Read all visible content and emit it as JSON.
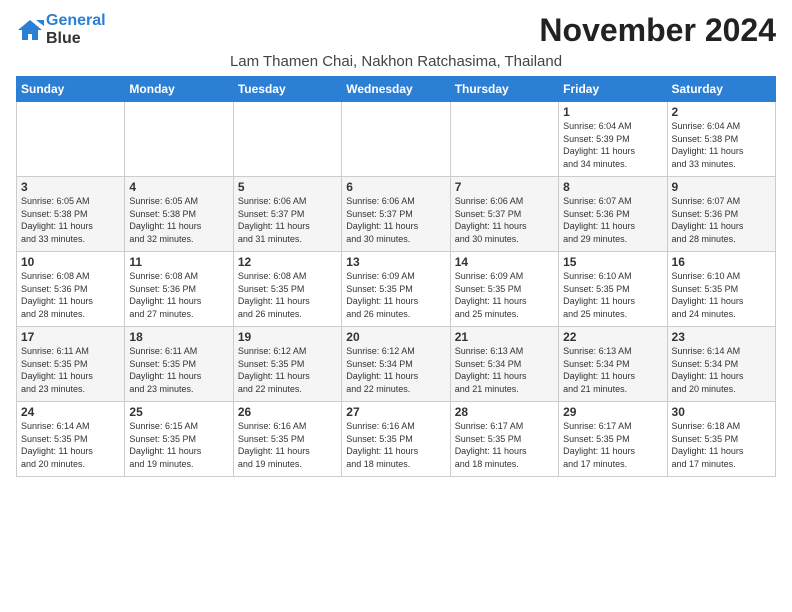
{
  "header": {
    "logo_line1": "General",
    "logo_line2": "Blue",
    "month_title": "November 2024",
    "location": "Lam Thamen Chai, Nakhon Ratchasima, Thailand"
  },
  "weekdays": [
    "Sunday",
    "Monday",
    "Tuesday",
    "Wednesday",
    "Thursday",
    "Friday",
    "Saturday"
  ],
  "weeks": [
    [
      {
        "day": "",
        "info": ""
      },
      {
        "day": "",
        "info": ""
      },
      {
        "day": "",
        "info": ""
      },
      {
        "day": "",
        "info": ""
      },
      {
        "day": "",
        "info": ""
      },
      {
        "day": "1",
        "info": "Sunrise: 6:04 AM\nSunset: 5:39 PM\nDaylight: 11 hours\nand 34 minutes."
      },
      {
        "day": "2",
        "info": "Sunrise: 6:04 AM\nSunset: 5:38 PM\nDaylight: 11 hours\nand 33 minutes."
      }
    ],
    [
      {
        "day": "3",
        "info": "Sunrise: 6:05 AM\nSunset: 5:38 PM\nDaylight: 11 hours\nand 33 minutes."
      },
      {
        "day": "4",
        "info": "Sunrise: 6:05 AM\nSunset: 5:38 PM\nDaylight: 11 hours\nand 32 minutes."
      },
      {
        "day": "5",
        "info": "Sunrise: 6:06 AM\nSunset: 5:37 PM\nDaylight: 11 hours\nand 31 minutes."
      },
      {
        "day": "6",
        "info": "Sunrise: 6:06 AM\nSunset: 5:37 PM\nDaylight: 11 hours\nand 30 minutes."
      },
      {
        "day": "7",
        "info": "Sunrise: 6:06 AM\nSunset: 5:37 PM\nDaylight: 11 hours\nand 30 minutes."
      },
      {
        "day": "8",
        "info": "Sunrise: 6:07 AM\nSunset: 5:36 PM\nDaylight: 11 hours\nand 29 minutes."
      },
      {
        "day": "9",
        "info": "Sunrise: 6:07 AM\nSunset: 5:36 PM\nDaylight: 11 hours\nand 28 minutes."
      }
    ],
    [
      {
        "day": "10",
        "info": "Sunrise: 6:08 AM\nSunset: 5:36 PM\nDaylight: 11 hours\nand 28 minutes."
      },
      {
        "day": "11",
        "info": "Sunrise: 6:08 AM\nSunset: 5:36 PM\nDaylight: 11 hours\nand 27 minutes."
      },
      {
        "day": "12",
        "info": "Sunrise: 6:08 AM\nSunset: 5:35 PM\nDaylight: 11 hours\nand 26 minutes."
      },
      {
        "day": "13",
        "info": "Sunrise: 6:09 AM\nSunset: 5:35 PM\nDaylight: 11 hours\nand 26 minutes."
      },
      {
        "day": "14",
        "info": "Sunrise: 6:09 AM\nSunset: 5:35 PM\nDaylight: 11 hours\nand 25 minutes."
      },
      {
        "day": "15",
        "info": "Sunrise: 6:10 AM\nSunset: 5:35 PM\nDaylight: 11 hours\nand 25 minutes."
      },
      {
        "day": "16",
        "info": "Sunrise: 6:10 AM\nSunset: 5:35 PM\nDaylight: 11 hours\nand 24 minutes."
      }
    ],
    [
      {
        "day": "17",
        "info": "Sunrise: 6:11 AM\nSunset: 5:35 PM\nDaylight: 11 hours\nand 23 minutes."
      },
      {
        "day": "18",
        "info": "Sunrise: 6:11 AM\nSunset: 5:35 PM\nDaylight: 11 hours\nand 23 minutes."
      },
      {
        "day": "19",
        "info": "Sunrise: 6:12 AM\nSunset: 5:35 PM\nDaylight: 11 hours\nand 22 minutes."
      },
      {
        "day": "20",
        "info": "Sunrise: 6:12 AM\nSunset: 5:34 PM\nDaylight: 11 hours\nand 22 minutes."
      },
      {
        "day": "21",
        "info": "Sunrise: 6:13 AM\nSunset: 5:34 PM\nDaylight: 11 hours\nand 21 minutes."
      },
      {
        "day": "22",
        "info": "Sunrise: 6:13 AM\nSunset: 5:34 PM\nDaylight: 11 hours\nand 21 minutes."
      },
      {
        "day": "23",
        "info": "Sunrise: 6:14 AM\nSunset: 5:34 PM\nDaylight: 11 hours\nand 20 minutes."
      }
    ],
    [
      {
        "day": "24",
        "info": "Sunrise: 6:14 AM\nSunset: 5:35 PM\nDaylight: 11 hours\nand 20 minutes."
      },
      {
        "day": "25",
        "info": "Sunrise: 6:15 AM\nSunset: 5:35 PM\nDaylight: 11 hours\nand 19 minutes."
      },
      {
        "day": "26",
        "info": "Sunrise: 6:16 AM\nSunset: 5:35 PM\nDaylight: 11 hours\nand 19 minutes."
      },
      {
        "day": "27",
        "info": "Sunrise: 6:16 AM\nSunset: 5:35 PM\nDaylight: 11 hours\nand 18 minutes."
      },
      {
        "day": "28",
        "info": "Sunrise: 6:17 AM\nSunset: 5:35 PM\nDaylight: 11 hours\nand 18 minutes."
      },
      {
        "day": "29",
        "info": "Sunrise: 6:17 AM\nSunset: 5:35 PM\nDaylight: 11 hours\nand 17 minutes."
      },
      {
        "day": "30",
        "info": "Sunrise: 6:18 AM\nSunset: 5:35 PM\nDaylight: 11 hours\nand 17 minutes."
      }
    ]
  ]
}
